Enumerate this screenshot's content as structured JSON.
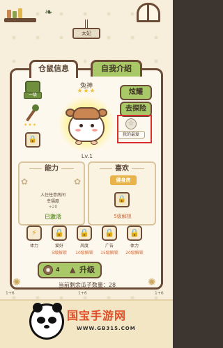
{
  "room": {
    "sign": "太妃",
    "floor_labels": [
      "1+6",
      "1+6",
      "1+6"
    ]
  },
  "tabs": {
    "info": "仓鼠信息",
    "intro": "自我介绍"
  },
  "hamster": {
    "name": "兔神",
    "stars": "★★★",
    "level": "Lv.1",
    "badge": "一级"
  },
  "left_items": {
    "stick_stars": "★★★",
    "lock_glyph": "🔒"
  },
  "buttons": {
    "show_off": "炫耀",
    "explore": "去探险"
  },
  "favorite": {
    "label": "我的最爱",
    "icon": "☆"
  },
  "ability": {
    "title": "能力",
    "text": "入住任意房间\n幸福度",
    "value": "+20",
    "status": "已激活"
  },
  "like": {
    "title": "喜欢",
    "tag": "健身房",
    "unlock": "5级解锁"
  },
  "skills": [
    {
      "name": "体力",
      "sub": "",
      "icon": "⚡"
    },
    {
      "name": "爱好",
      "sub": "5级解锁",
      "icon": "🔒"
    },
    {
      "name": "风度",
      "sub": "10级解锁",
      "icon": "🔒"
    },
    {
      "name": "广告",
      "sub": "15级解锁",
      "icon": "🔒"
    },
    {
      "name": "体力",
      "sub": "20级解锁",
      "icon": "🔒"
    }
  ],
  "upgrade": {
    "cost": "4",
    "label": "升级"
  },
  "seeds_info": "当前剩余瓜子数量：28",
  "watermark": {
    "title": "国宝手游网",
    "url": "WWW.GB315.COM"
  },
  "colors": {
    "accent_green": "#a9c868",
    "border_brown": "#6b4a36",
    "highlight_red": "#d92c2c"
  }
}
